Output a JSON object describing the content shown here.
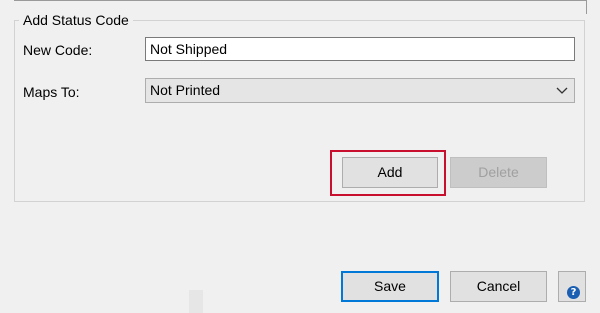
{
  "group": {
    "title": "Add Status Code"
  },
  "form": {
    "new_code_label": "New Code:",
    "new_code_value": "Not Shipped",
    "maps_to_label": "Maps To:",
    "maps_to_value": "Not Printed"
  },
  "buttons": {
    "add": "Add",
    "delete": "Delete",
    "save": "Save",
    "cancel": "Cancel",
    "help_glyph": "?"
  },
  "colors": {
    "highlight": "#c8102e",
    "save_border": "#0078d7",
    "help_icon": "#1b5fb3"
  },
  "icons": {
    "dropdown": "chevron-down-icon",
    "help": "help-icon"
  }
}
